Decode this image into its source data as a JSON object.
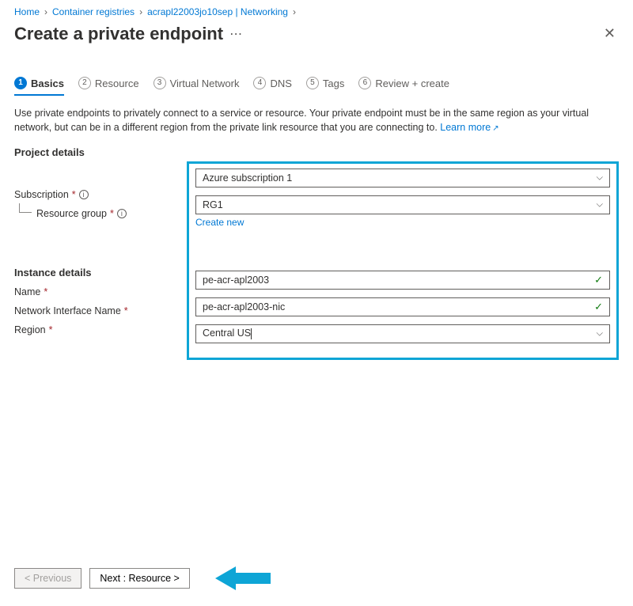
{
  "breadcrumb": {
    "home": "Home",
    "registries": "Container registries",
    "resource": "acrapl22003jo10sep | Networking"
  },
  "header": {
    "title": "Create a private endpoint"
  },
  "tabs": {
    "basics": "Basics",
    "resource": "Resource",
    "vnet": "Virtual Network",
    "dns": "DNS",
    "tags": "Tags",
    "review": "Review + create"
  },
  "description": {
    "text": "Use private endpoints to privately connect to a service or resource. Your private endpoint must be in the same region as your virtual network, but can be in a different region from the private link resource that you are connecting to.",
    "learn_more": "Learn more"
  },
  "sections": {
    "project": "Project details",
    "instance": "Instance details"
  },
  "labels": {
    "subscription": "Subscription",
    "resource_group": "Resource group",
    "create_new": "Create new",
    "name": "Name",
    "nic_name": "Network Interface Name",
    "region": "Region"
  },
  "values": {
    "subscription": "Azure subscription 1",
    "resource_group": "RG1",
    "name": "pe-acr-apl2003",
    "nic_name": "pe-acr-apl2003-nic",
    "region": "Central US"
  },
  "buttons": {
    "previous": "< Previous",
    "next": "Next : Resource >"
  }
}
